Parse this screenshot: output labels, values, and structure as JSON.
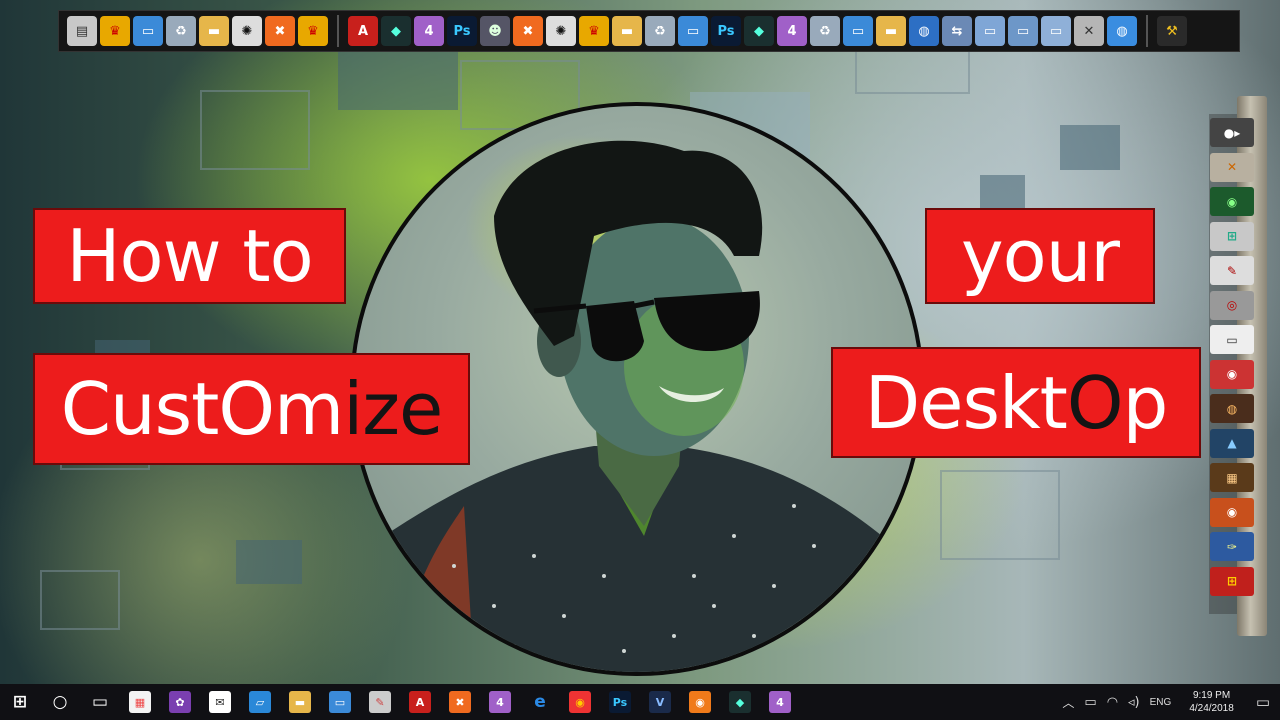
{
  "title": {
    "line1": "How to",
    "line2_a": "CustOm",
    "line2_b": "ize",
    "line3": "your",
    "line4_a": "Deskt",
    "line4_b": "O",
    "line4_c": "p"
  },
  "top_dock": {
    "icons": [
      {
        "name": "board-icon",
        "glyph": "▤",
        "bg": "#c8c8c8",
        "fg": "#333"
      },
      {
        "name": "app-icon-a",
        "glyph": "♛",
        "bg": "#e8a800",
        "fg": "#c00"
      },
      {
        "name": "computer-icon",
        "glyph": "▭",
        "bg": "#3b8ad8",
        "fg": "#fff"
      },
      {
        "name": "recycle-bin-icon",
        "glyph": "♻",
        "bg": "#9ab",
        "fg": "#fff"
      },
      {
        "name": "folder-icon",
        "glyph": "▬",
        "bg": "#e6b64a",
        "fg": "#fff"
      },
      {
        "name": "film-reel-icon",
        "glyph": "✺",
        "bg": "#ddd",
        "fg": "#111"
      },
      {
        "name": "xampp-icon",
        "glyph": "✖",
        "bg": "#f06a1f",
        "fg": "#fff"
      },
      {
        "name": "app-icon-b",
        "glyph": "♛",
        "bg": "#e8a800",
        "fg": "#c00"
      },
      {
        "name": "divider",
        "glyph": "",
        "bg": "",
        "fg": ""
      },
      {
        "name": "acrobat-icon",
        "glyph": "A",
        "bg": "#c8201c",
        "fg": "#fff"
      },
      {
        "name": "filmora-icon",
        "glyph": "◆",
        "bg": "#1a2f2f",
        "fg": "#5fd"
      },
      {
        "name": "premiere-icon",
        "glyph": "4",
        "bg": "#a060c8",
        "fg": "#fff"
      },
      {
        "name": "photoshop-icon",
        "glyph": "Ps",
        "bg": "#0a1a33",
        "fg": "#3ac8ff"
      },
      {
        "name": "user-avatar-icon",
        "glyph": "☻",
        "bg": "#556",
        "fg": "#dfd"
      },
      {
        "name": "xampp-icon",
        "glyph": "✖",
        "bg": "#f06a1f",
        "fg": "#fff"
      },
      {
        "name": "film-reel-icon",
        "glyph": "✺",
        "bg": "#ddd",
        "fg": "#111"
      },
      {
        "name": "app-icon-c",
        "glyph": "♛",
        "bg": "#e8a800",
        "fg": "#c00"
      },
      {
        "name": "folder-icon",
        "glyph": "▬",
        "bg": "#e6b64a",
        "fg": "#fff"
      },
      {
        "name": "recycle-bin-icon",
        "glyph": "♻",
        "bg": "#9ab",
        "fg": "#fff"
      },
      {
        "name": "computer-icon",
        "glyph": "▭",
        "bg": "#3b8ad8",
        "fg": "#fff"
      },
      {
        "name": "photoshop-icon",
        "glyph": "Ps",
        "bg": "#0a1a33",
        "fg": "#3ac8ff"
      },
      {
        "name": "filmora-icon",
        "glyph": "◆",
        "bg": "#1a2f2f",
        "fg": "#5fd"
      },
      {
        "name": "premiere-icon",
        "glyph": "4",
        "bg": "#a060c8",
        "fg": "#fff"
      },
      {
        "name": "recycle-bin-icon",
        "glyph": "♻",
        "bg": "#9ab",
        "fg": "#fff"
      },
      {
        "name": "computer-icon",
        "glyph": "▭",
        "bg": "#3b8ad8",
        "fg": "#fff"
      },
      {
        "name": "folder-icon",
        "glyph": "▬",
        "bg": "#e6b64a",
        "fg": "#fff"
      },
      {
        "name": "network-globe-icon",
        "glyph": "◍",
        "bg": "#2d6fc4",
        "fg": "#fff"
      },
      {
        "name": "network-icon",
        "glyph": "⇆",
        "bg": "#6b89b5",
        "fg": "#fff"
      },
      {
        "name": "folder-open-icon",
        "glyph": "▭",
        "bg": "#7fa6d6",
        "fg": "#fff"
      },
      {
        "name": "folder-blue-icon",
        "glyph": "▭",
        "bg": "#6d97c8",
        "fg": "#fff"
      },
      {
        "name": "folder-docs-icon",
        "glyph": "▭",
        "bg": "#8fb0d8",
        "fg": "#fff"
      },
      {
        "name": "tools-icon",
        "glyph": "✕",
        "bg": "#b5b5b5",
        "fg": "#333"
      },
      {
        "name": "internet-globe-icon",
        "glyph": "◍",
        "bg": "#3a8de0",
        "fg": "#fff"
      },
      {
        "name": "divider",
        "glyph": "",
        "bg": "",
        "fg": ""
      },
      {
        "name": "hammer-icon",
        "glyph": "⚒",
        "bg": "#2a2a2a",
        "fg": "#f0c020"
      }
    ]
  },
  "right_dock": {
    "icons": [
      {
        "name": "media-controls-icon",
        "glyph": "●▸",
        "bg": "#444",
        "fg": "#fff"
      },
      {
        "name": "tools-settings-icon",
        "glyph": "✕",
        "bg": "#b8b0a0",
        "fg": "#c60"
      },
      {
        "name": "radar-icon",
        "glyph": "◉",
        "bg": "#1c5a2c",
        "fg": "#8f8"
      },
      {
        "name": "windows-flag-icon",
        "glyph": "⊞",
        "bg": "#c8c8c8",
        "fg": "#2a8"
      },
      {
        "name": "edit-document-icon",
        "glyph": "✎",
        "bg": "#ddd",
        "fg": "#a00"
      },
      {
        "name": "disc-burn-icon",
        "glyph": "◎",
        "bg": "#999",
        "fg": "#b00"
      },
      {
        "name": "window-panel-icon",
        "glyph": "▭",
        "bg": "#eee",
        "fg": "#333"
      },
      {
        "name": "media-player-icon",
        "glyph": "◉",
        "bg": "#c33",
        "fg": "#fff"
      },
      {
        "name": "speaker-icon",
        "glyph": "◍",
        "bg": "#4a2d1c",
        "fg": "#fb6"
      },
      {
        "name": "image-viewer-icon",
        "glyph": "▲",
        "bg": "#246",
        "fg": "#8cf"
      },
      {
        "name": "film-strip-icon",
        "glyph": "▦",
        "bg": "#5a3a1a",
        "fg": "#fc8"
      },
      {
        "name": "camera-icon",
        "glyph": "◉",
        "bg": "#c8501c",
        "fg": "#fff"
      },
      {
        "name": "wrench-icon",
        "glyph": "✑",
        "bg": "#2d5aa0",
        "fg": "#ff8"
      },
      {
        "name": "windows-logo-icon",
        "glyph": "⊞",
        "bg": "#c0201c",
        "fg": "#fc0"
      }
    ]
  },
  "taskbar": {
    "icons": [
      {
        "name": "start-button",
        "glyph": "⊞",
        "bg": "transparent",
        "fg": "#fff"
      },
      {
        "name": "search-button",
        "glyph": "○",
        "bg": "transparent",
        "fg": "#fff"
      },
      {
        "name": "task-view-button",
        "glyph": "▭",
        "bg": "transparent",
        "fg": "#fff"
      },
      {
        "name": "store-icon",
        "glyph": "▦",
        "bg": "#f3f3f3",
        "fg": "#e44"
      },
      {
        "name": "picasa-icon",
        "glyph": "✿",
        "bg": "#7a3fb0",
        "fg": "#fff"
      },
      {
        "name": "mail-icon",
        "glyph": "✉",
        "bg": "#fff",
        "fg": "#222"
      },
      {
        "name": "maps-icon",
        "glyph": "▱",
        "bg": "#2a88d8",
        "fg": "#fff"
      },
      {
        "name": "file-explorer-icon",
        "glyph": "▬",
        "bg": "#e6b64a",
        "fg": "#fff"
      },
      {
        "name": "computer-icon",
        "glyph": "▭",
        "bg": "#3b8ad8",
        "fg": "#fff"
      },
      {
        "name": "paint-icon",
        "glyph": "✎",
        "bg": "#ccc",
        "fg": "#c44"
      },
      {
        "name": "acrobat-icon",
        "glyph": "A",
        "bg": "#c8201c",
        "fg": "#fff"
      },
      {
        "name": "xampp-icon",
        "glyph": "✖",
        "bg": "#f06a1f",
        "fg": "#fff"
      },
      {
        "name": "premiere-icon",
        "glyph": "4",
        "bg": "#a060c8",
        "fg": "#fff"
      },
      {
        "name": "edge-icon",
        "glyph": "e",
        "bg": "transparent",
        "fg": "#2b8ae6"
      },
      {
        "name": "chrome-icon",
        "glyph": "◉",
        "bg": "#e33",
        "fg": "#fc0"
      },
      {
        "name": "photoshop-icon",
        "glyph": "Ps",
        "bg": "#0a1a33",
        "fg": "#3ac8ff"
      },
      {
        "name": "v-app-icon",
        "glyph": "V",
        "bg": "#1a2a4a",
        "fg": "#8bf"
      },
      {
        "name": "firefox-icon",
        "glyph": "◉",
        "bg": "#f07a1a",
        "fg": "#fff"
      },
      {
        "name": "filmora-icon",
        "glyph": "◆",
        "bg": "#1a2f2f",
        "fg": "#5fd"
      },
      {
        "name": "premiere-icon",
        "glyph": "4",
        "bg": "#a060c8",
        "fg": "#fff"
      }
    ]
  },
  "tray": {
    "language": "ENG",
    "time": "9:19 PM",
    "date": "4/24/2018"
  },
  "colors": {
    "title_bg": "#ed1c1c",
    "title_text": "#ffffff",
    "title_dark_text": "#141414"
  }
}
